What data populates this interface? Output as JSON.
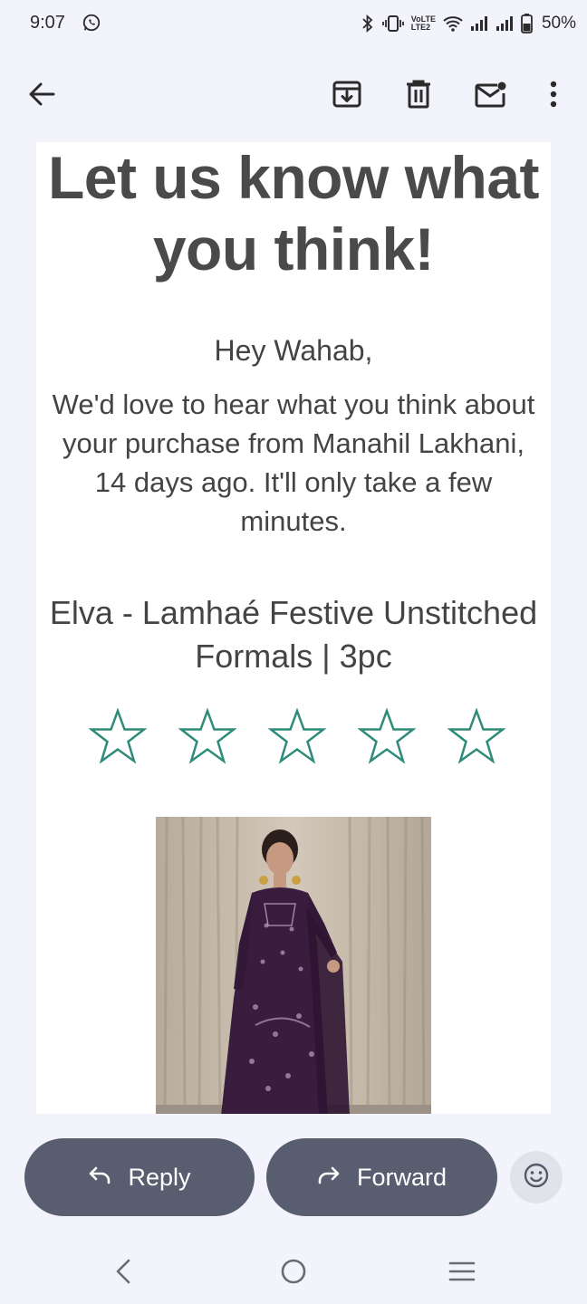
{
  "status_bar": {
    "time": "9:07",
    "network_label_top": "VoLTE",
    "network_label_bottom": "LTE2",
    "battery": "50%"
  },
  "toolbar": {
    "icons": [
      "back-arrow-icon",
      "archive-icon",
      "delete-icon",
      "mark-unread-icon",
      "more-vert-icon"
    ]
  },
  "email": {
    "headline": "Let us know what you think!",
    "greeting": "Hey Wahab,",
    "message": "We'd love to hear what you think about your purchase from Manahil Lakhani, 14 days ago. It'll only take a few minutes.",
    "product_name": "Elva - Lamhaé Festive Unstitched Formals | 3pc",
    "rating": {
      "max_stars": 5,
      "selected": 0
    },
    "star_color": "#2e8b7a"
  },
  "actions": {
    "reply_label": "Reply",
    "forward_label": "Forward"
  },
  "colors": {
    "background": "#f3f4fb",
    "pill_button": "#595d70",
    "headline_text": "#4a4a4a"
  }
}
